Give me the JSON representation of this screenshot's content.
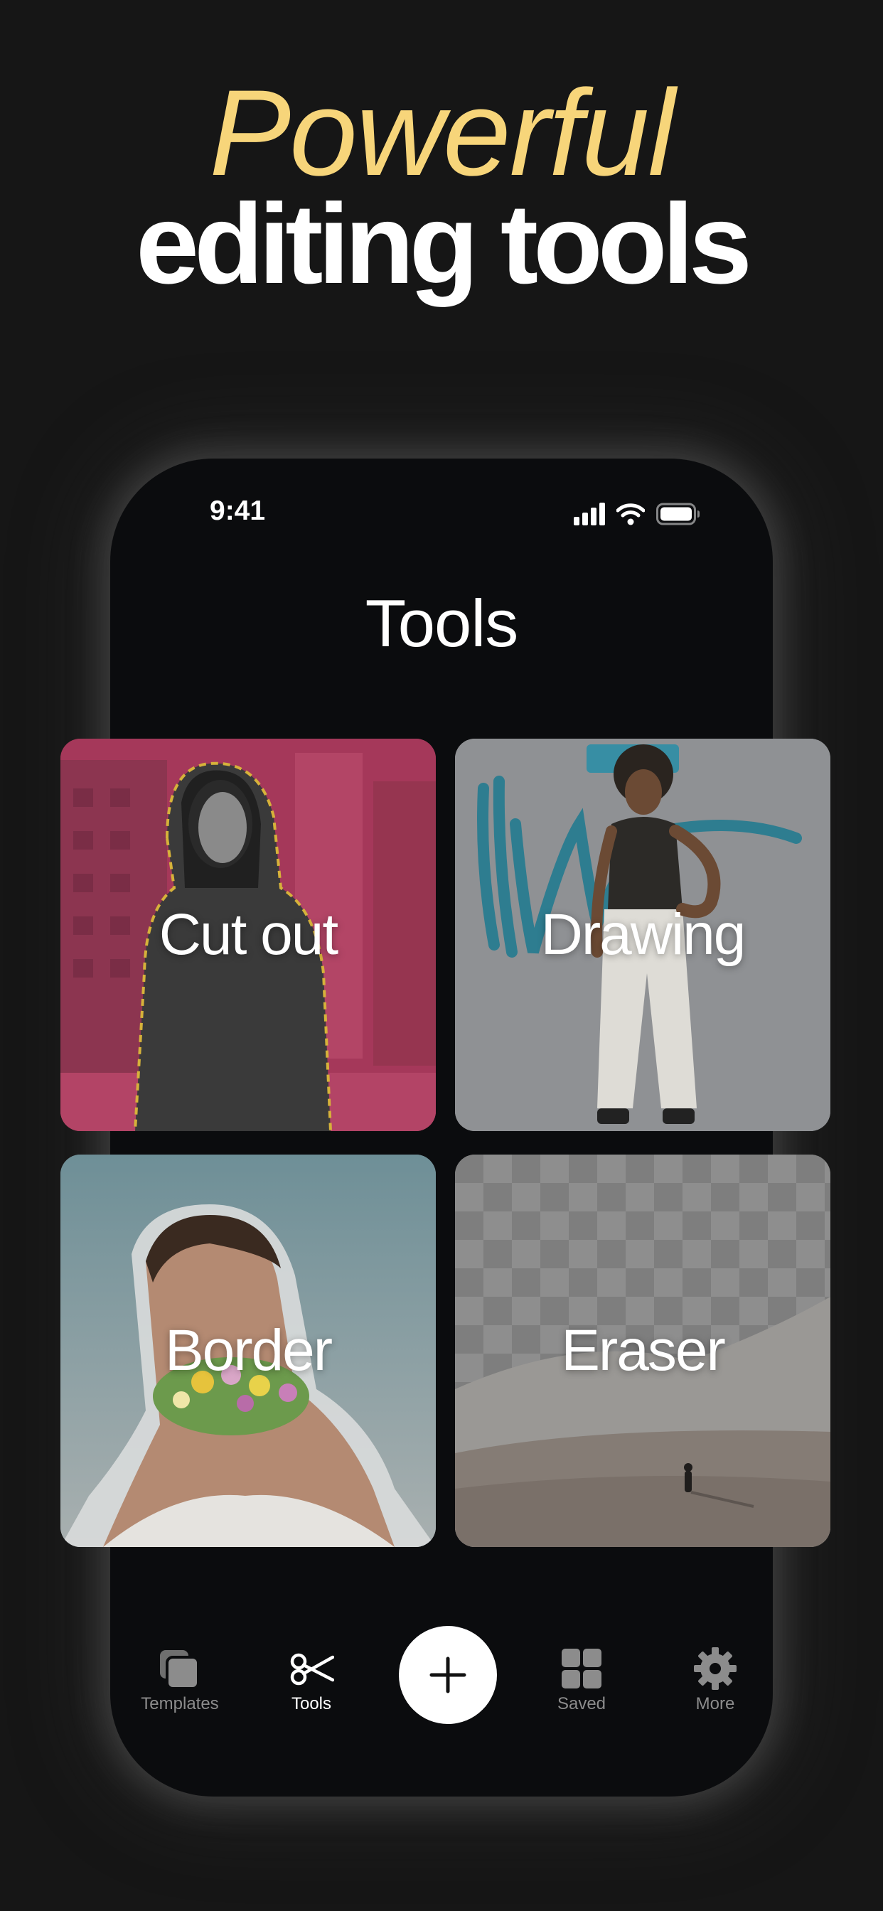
{
  "hero": {
    "line1": "Powerful",
    "line2": "editing tools"
  },
  "status_bar": {
    "time": "9:41",
    "icons": [
      "signal-icon",
      "wifi-icon",
      "battery-icon"
    ]
  },
  "screen": {
    "title": "Tools"
  },
  "tools": [
    {
      "label": "Cut out"
    },
    {
      "label": "Drawing"
    },
    {
      "label": "Border"
    },
    {
      "label": "Eraser"
    }
  ],
  "tabbar": {
    "templates": {
      "label": "Templates",
      "icon": "templates-icon"
    },
    "tools": {
      "label": "Tools",
      "icon": "scissors-icon"
    },
    "add": {
      "icon": "plus-icon"
    },
    "saved": {
      "label": "Saved",
      "icon": "grid-icon"
    },
    "more": {
      "label": "More",
      "icon": "gear-icon"
    }
  },
  "colors": {
    "background": "#161616",
    "phone": "#0b0c0e",
    "accent_yellow": "#f7d57a",
    "text_white": "#ffffff",
    "tab_inactive": "#8c8c8c",
    "tab_active": "#ffffff",
    "cutout_tint": "#a5385a"
  }
}
